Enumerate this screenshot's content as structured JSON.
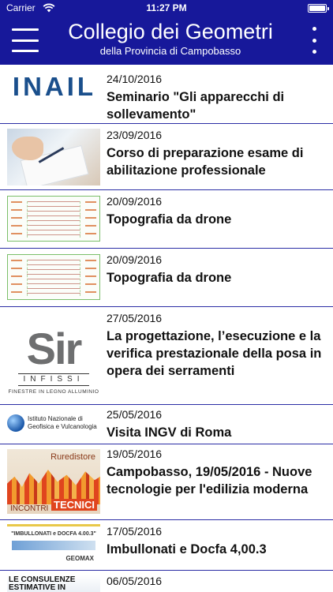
{
  "status_bar": {
    "carrier": "Carrier",
    "time": "11:27 PM",
    "battery_level": 1.0,
    "wifi_icon": "wifi-icon"
  },
  "header": {
    "title": "Collegio dei Geometri",
    "subtitle": "della Provincia di Campobasso",
    "menu_icon": "hamburger-menu-icon",
    "more_icon": "more-vertical-icon",
    "background": "#17189a"
  },
  "news": [
    {
      "date": "24/10/2016",
      "title": "Seminario \"Gli apparecchi di sollevamento\"",
      "thumb_text": "INAIL"
    },
    {
      "date": "23/09/2016",
      "title": "Corso di preparazione esame di abilitazione professionale"
    },
    {
      "date": "20/09/2016",
      "title": "Topografia da drone"
    },
    {
      "date": "20/09/2016",
      "title": "Topografia da drone"
    },
    {
      "date": "27/05/2016",
      "title": "La progettazione, l’esecuzione e la verifica prestazionale della posa in opera dei serramenti",
      "thumb_text": {
        "logo": "Sir",
        "brand": "INFISSI",
        "tagline": "FINESTRE IN LEGNO ALLUMINIO"
      }
    },
    {
      "date": "25/05/2016",
      "title": "Visita INGV di Roma",
      "thumb_text": {
        "line1": "Istituto Nazionale di",
        "line2": "Geofisica e Vulcanologia"
      }
    },
    {
      "date": "19/05/2016",
      "title": "Campobasso, 19/05/2016 - Nuove tecnologie per l'edilizia moderna",
      "thumb_text": {
        "brand": "Ruredistore",
        "label": "INCONTRI",
        "badge": "TECNICI"
      }
    },
    {
      "date": "17/05/2016",
      "title": "Imbullonati e Docfa 4,00.3",
      "thumb_text": {
        "head": "\"IMBULLONATI e DOCFA 4.00.3\"",
        "footer": "GEOMAX"
      }
    },
    {
      "date": "06/05/2016",
      "title": "",
      "thumb_text": "LE CONSULENZE ESTIMATIVE IN"
    }
  ]
}
